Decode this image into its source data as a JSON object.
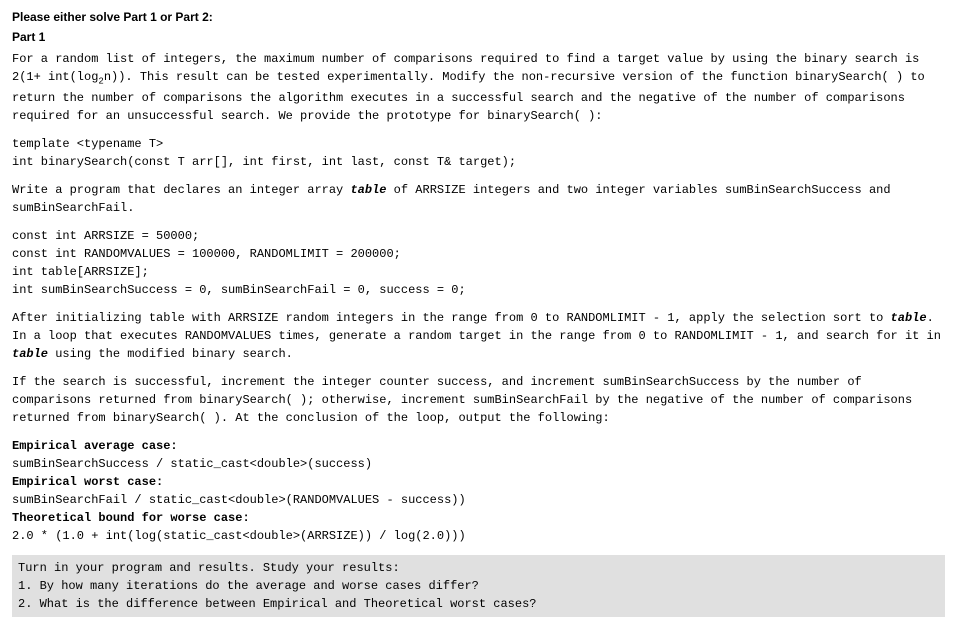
{
  "header": "Please either solve Part 1 or Part 2:",
  "partLabel": "Part 1",
  "p1a": "For a random list of integers, the maximum number of comparisons required to find a target value by using the binary search is 2(1+ int(log",
  "p1sub": "2",
  "p1b": "n)). This result can be tested experimentally. Modify the non-recursive version of the function binarySearch( ) to return the number of comparisons the algorithm executes in a successful search and the negative of the number of comparisons required for an unsuccessful search. We provide the prototype for binarySearch( ):",
  "proto1": "template <typename T>",
  "proto2": "int binarySearch(const T arr[], int first, int last, const T& target);",
  "p2a": "Write a program that declares an integer array ",
  "tableWord": "table",
  "p2b": " of ARRSIZE integers and two integer variables sumBinSearchSuccess and sumBinSearchFail.",
  "decl1": "const int ARRSIZE = 50000;",
  "decl2": "const int RANDOMVALUES = 100000, RANDOMLIMIT = 200000;",
  "decl3": "int table[ARRSIZE];",
  "decl4": "int sumBinSearchSuccess = 0, sumBinSearchFail = 0, success = 0;",
  "p3a": "After initializing table with ARRSIZE random integers in the range from 0 to RANDOMLIMIT - 1, apply the selection sort to ",
  "p3b": ". In a loop that executes RANDOMVALUES times, generate a random target in the range from 0 to RANDOMLIMIT - 1, and search for it in ",
  "p3c": " using the modified binary search.",
  "p4": "If the search is successful, increment the integer counter success, and increment sumBinSearchSuccess by the number of comparisons returned from binarySearch( ); otherwise, increment sumBinSearchFail by the negative of the number of comparisons returned from binarySearch( ). At the conclusion of the loop, output the following:",
  "empAvgLabel": "Empirical average case:",
  "empAvgExpr": "sumBinSearchSuccess / static_cast<double>(success)",
  "empWorstLabel": "Empirical worst case:",
  "empWorstExpr": "sumBinSearchFail / static_cast<double>(RANDOMVALUES - success))",
  "theoLabel": "Theoretical bound for worse case:",
  "theoExpr": "2.0 * (1.0 + int(log(static_cast<double>(ARRSIZE)) / log(2.0)))",
  "footer1": "Turn in your program and results. Study your results:",
  "footer2": "1. By how many iterations do the average and worse cases differ?",
  "footer3": "2. What is the difference between Empirical and Theoretical worst cases?"
}
